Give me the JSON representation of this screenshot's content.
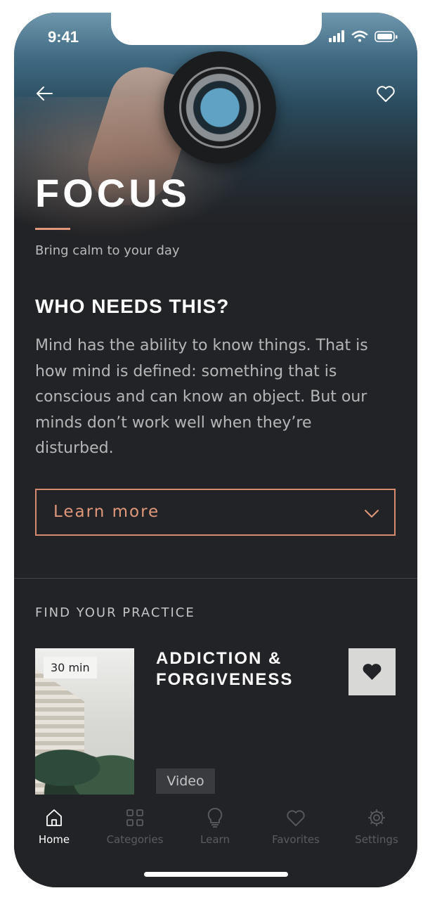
{
  "status_bar": {
    "time": "9:41"
  },
  "header": {
    "title": "FOCUS",
    "subtitle": "Bring calm to your day"
  },
  "intro": {
    "heading": "WHO NEEDS THIS?",
    "body": "Mind has the ability to know things. That is how mind is defined: something that is conscious and can know an object. But our minds don’t work well when they’re disturbed."
  },
  "learn_more": {
    "label": "Learn more"
  },
  "practice": {
    "section_label": "FIND YOUR PRACTICE",
    "card": {
      "duration": "30 min",
      "title": "ADDICTION & FORGIVENESS",
      "type": "Video"
    }
  },
  "tabbar": {
    "items": [
      {
        "label": "Home",
        "icon": "home-icon",
        "active": true
      },
      {
        "label": "Categories",
        "icon": "grid-icon",
        "active": false
      },
      {
        "label": "Learn",
        "icon": "lightbulb-icon",
        "active": false
      },
      {
        "label": "Favorites",
        "icon": "heart-icon",
        "active": false
      },
      {
        "label": "Settings",
        "icon": "gear-icon",
        "active": false
      }
    ]
  },
  "colors": {
    "background": "#222326",
    "accent": "#e0977a",
    "text": "#ffffff",
    "muted": "#b5b6b8"
  }
}
